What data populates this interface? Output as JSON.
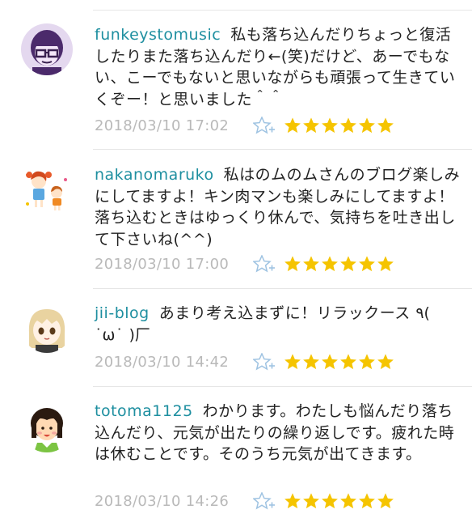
{
  "colors": {
    "username": "#1e8fa0",
    "star": "#f5c400",
    "add_star": "#9fc3e2",
    "timestamp": "#b9b9b9"
  },
  "comments": [
    {
      "username": "funkeystomusic",
      "text": "私も落ち込んだりちょっと復活したりまた落ち込んだり←(笑)だけど、あーでもない、こーでもないと思いながらも頑張って生きていくぞー！と思いました＾＾",
      "timestamp": "2018/03/10 17:02",
      "stars": 6,
      "avatar_icon": "glasses-person-avatar-icon"
    },
    {
      "username": "nakanomaruko",
      "text": "私はのムのムさんのブログ楽しみにしてますよ！キン肉マンも楽しみにしてますよ！落ち込むときはゆっくり休んで、気持ちを吐き出して下さいね(^^)",
      "timestamp": "2018/03/10 17:00",
      "stars": 6,
      "avatar_icon": "two-kids-avatar-icon"
    },
    {
      "username": "jii-blog",
      "text": "あまり考え込まずに！リラックース ٩( ˙ω˙ )厂",
      "timestamp": "2018/03/10 14:42",
      "stars": 6,
      "avatar_icon": "anime-girl-avatar-icon"
    },
    {
      "username": "totoma1125",
      "text": "わかります。わたしも悩んだり落ち込んだり、元気が出たりの繰り返しです。疲れた時は休むことです。そのうち元気が出てきます。",
      "timestamp": "2018/03/10 14:26",
      "stars": 6,
      "avatar_icon": "bob-hair-avatar-icon"
    }
  ]
}
